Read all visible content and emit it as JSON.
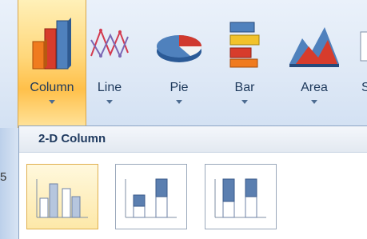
{
  "ribbon": {
    "buttons": [
      {
        "label": "Column",
        "icon": "column-chart-icon",
        "selected": true
      },
      {
        "label": "Line",
        "icon": "line-chart-icon"
      },
      {
        "label": "Pie",
        "icon": "pie-chart-icon"
      },
      {
        "label": "Bar",
        "icon": "bar-chart-icon"
      },
      {
        "label": "Area",
        "icon": "area-chart-icon"
      },
      {
        "label": "S",
        "icon": "scatter-chart-icon"
      }
    ]
  },
  "gallery": {
    "header": "2-D Column",
    "subtypes": [
      {
        "icon": "clustered-column-icon",
        "selected": true
      },
      {
        "icon": "stacked-column-icon"
      },
      {
        "icon": "100-percent-stacked-column-icon"
      }
    ]
  },
  "background_text": "5",
  "colors": {
    "accent": "#ffc04a",
    "ribbon": "#dfe9f6",
    "text": "#1e395b"
  }
}
